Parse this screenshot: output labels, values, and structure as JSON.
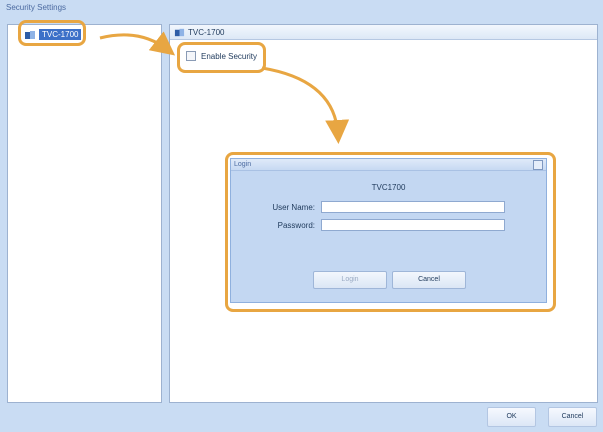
{
  "window": {
    "title": "Security Settings"
  },
  "tree": {
    "device_label": "TVC-1700"
  },
  "right_panel": {
    "header_label": "TVC-1700",
    "enable_security_label": "Enable Security"
  },
  "login_dialog": {
    "title": "Login",
    "device_name": "TVC1700",
    "username_label": "User Name:",
    "username_value": "",
    "password_label": "Password:",
    "password_value": "",
    "login_button": "Login",
    "cancel_button": "Cancel"
  },
  "footer": {
    "ok_button": "OK",
    "cancel_button": "Cancel"
  },
  "colors": {
    "accent": "#e8a642",
    "selection": "#3c70c8",
    "background": "#c9dcf3"
  },
  "icons": {
    "device": "device-node-icon",
    "close": "close-icon"
  }
}
